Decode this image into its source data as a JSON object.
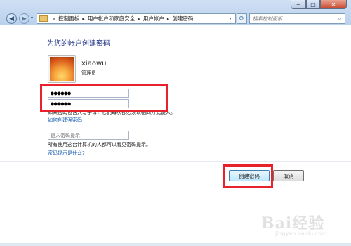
{
  "window": {
    "minimize_glyph": "─",
    "maximize_glyph": "□",
    "close_glyph": "✕"
  },
  "nav": {
    "back_glyph": "◀",
    "forward_glyph": "▶",
    "dropdown_glyph": "▾",
    "refresh_glyph": "⟳"
  },
  "breadcrumb": {
    "items": [
      "控制面板",
      "用户帐户和家庭安全",
      "用户帐户",
      "创建密码"
    ],
    "separator": "▸",
    "root_separator": "«"
  },
  "search": {
    "placeholder": "搜索控制面板",
    "icon": "search-icon"
  },
  "page": {
    "title": "为您的帐户创建密码"
  },
  "user": {
    "name": "xiaowu",
    "role": "管理员"
  },
  "form": {
    "new_password": "●●●●●●",
    "confirm_password": "●●●●●●",
    "note": "如果密码包含大写字母，它们每次都必须以相同方式键入。",
    "link_strong_password": "如何创建强密码",
    "hint_placeholder": "键入密码提示",
    "hint_visible_note": "所有使用这台计算机的人都可以看见密码提示。",
    "link_hint_what": "密码提示是什么?"
  },
  "buttons": {
    "create": "创建密码",
    "cancel": "取消"
  },
  "watermark": {
    "logo": "Bai经验",
    "url": "jingyan.baidu.com"
  },
  "colors": {
    "annotation": "#e8212b",
    "title": "#1e3287",
    "link": "#1b5fb3"
  }
}
